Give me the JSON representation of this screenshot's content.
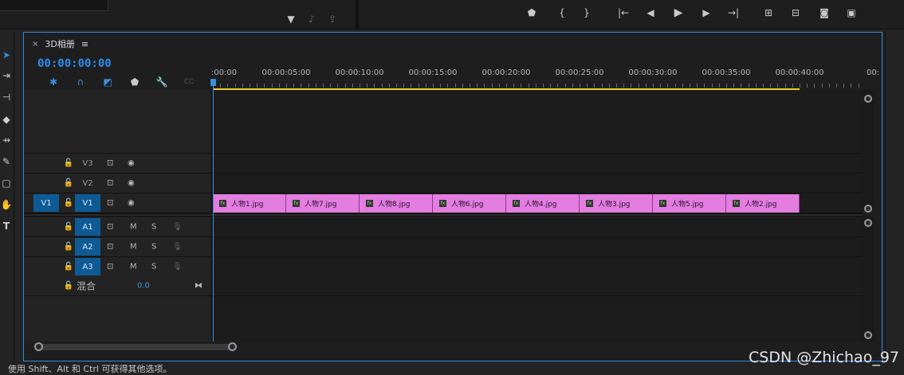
{
  "panel": {
    "title": "3D相册",
    "close_glyph": "×",
    "menu_glyph": "≡",
    "timecode": "00:00:00:00"
  },
  "ruler": {
    "labels": [
      ":00:00",
      "00:00:05:00",
      "00:00:10:00",
      "00:00:15:00",
      "00:00:20:00",
      "00:00:25:00",
      "00:00:30:00",
      "00:00:35:00",
      "00:00:40:00",
      "00:"
    ]
  },
  "tracks": {
    "video": [
      {
        "name": "V3",
        "target": "",
        "active": false
      },
      {
        "name": "V2",
        "target": "",
        "active": false
      },
      {
        "name": "V1",
        "target": "V1",
        "active": true
      }
    ],
    "audio": [
      {
        "name": "A1",
        "mute": "M",
        "solo": "S"
      },
      {
        "name": "A2",
        "mute": "M",
        "solo": "S"
      },
      {
        "name": "A3",
        "mute": "M",
        "solo": "S"
      }
    ],
    "mix": {
      "label": "混合",
      "value": "0.0"
    }
  },
  "clips": [
    {
      "label": "人物1.jpg"
    },
    {
      "label": "人物7.jpg"
    },
    {
      "label": "人物8.jpg"
    },
    {
      "label": "人物6.jpg"
    },
    {
      "label": "人物4.jpg"
    },
    {
      "label": "人物3.jpg"
    },
    {
      "label": "人物5.jpg"
    },
    {
      "label": "人物2.jpg"
    }
  ],
  "status_text": "使用 Shift、Alt 和 Ctrl 可获得其他选项。",
  "watermark": "CSDN @Zhichao_97",
  "colors": {
    "accent": "#2d8ceb",
    "clip": "#e37de0",
    "workarea": "#e6d22c"
  }
}
